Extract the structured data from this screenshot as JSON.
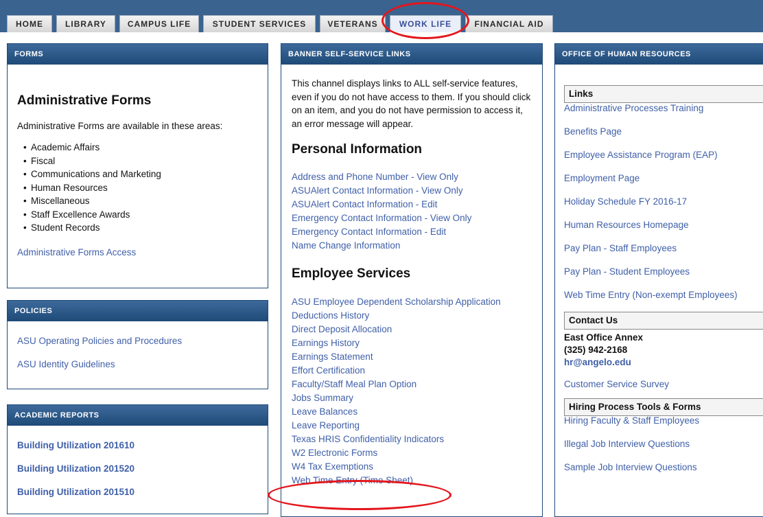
{
  "tabs": [
    {
      "label": "HOME"
    },
    {
      "label": "LIBRARY"
    },
    {
      "label": "CAMPUS LIFE"
    },
    {
      "label": "STUDENT SERVICES"
    },
    {
      "label": "VETERANS"
    },
    {
      "label": "WORK LIFE"
    },
    {
      "label": "FINANCIAL AID"
    }
  ],
  "forms": {
    "header": "FORMS",
    "title": "Administrative Forms",
    "intro": "Administrative Forms are available in these areas:",
    "areas": [
      "Academic Affairs",
      "Fiscal",
      "Communications and Marketing",
      "Human Resources",
      "Miscellaneous",
      "Staff Excellence Awards",
      "Student Records"
    ],
    "access_link": "Administrative Forms Access"
  },
  "policies": {
    "header": "POLICIES",
    "links": [
      "ASU Operating Policies and Procedures",
      "ASU Identity Guidelines"
    ]
  },
  "reports": {
    "header": "ACADEMIC REPORTS",
    "links": [
      "Building Utilization 201610",
      "Building Utilization 201520",
      "Building Utilization 201510"
    ]
  },
  "banner": {
    "header": "BANNER SELF-SERVICE LINKS",
    "intro": "This channel displays links to ALL self-service features, even if you do not have access to them. If you should click on an item, and you do not have permission to access it, an error message will appear.",
    "personal_title": "Personal Information",
    "personal_links": [
      "Address and Phone Number - View Only",
      "ASUAlert Contact Information - View Only",
      "ASUAlert Contact Information - Edit",
      "Emergency Contact Information - View Only",
      "Emergency Contact Information - Edit",
      "Name Change Information"
    ],
    "employee_title": "Employee Services",
    "employee_links": [
      "ASU Employee Dependent Scholarship Application",
      "Deductions History",
      "Direct Deposit Allocation",
      "Earnings History",
      "Earnings Statement",
      "Effort Certification",
      "Faculty/Staff Meal Plan Option",
      "Jobs Summary",
      "Leave Balances",
      "Leave Reporting",
      "Texas HRIS Confidentiality Indicators",
      "W2 Electronic Forms",
      "W4 Tax Exemptions",
      "Web Time Entry (Time Sheet)"
    ]
  },
  "hr": {
    "header": "OFFICE OF HUMAN RESOURCES",
    "links_title": "Links",
    "links": [
      "Administrative Processes Training",
      "Benefits Page",
      "Employee Assistance Program (EAP)",
      "Employment Page",
      "Holiday Schedule FY 2016-17",
      "Human Resources Homepage",
      "Pay Plan - Staff Employees",
      "Pay Plan - Student Employees",
      "Web Time Entry (Non-exempt Employees)"
    ],
    "contact_title": "Contact Us",
    "contact_office": "East Office Annex",
    "contact_phone": "(325) 942-2168",
    "contact_email": "hr@angelo.edu",
    "survey_link": "Customer Service Survey",
    "hiring_title": "Hiring Process Tools & Forms",
    "hiring_links": [
      "Hiring Faculty & Staff Employees",
      "Illegal Job Interview Questions",
      "Sample Job Interview Questions"
    ]
  },
  "colors": {
    "accent": "#e3171d",
    "nav": "#3a6390",
    "link": "#3f5fa8",
    "panel_header": "#1f4a78"
  }
}
